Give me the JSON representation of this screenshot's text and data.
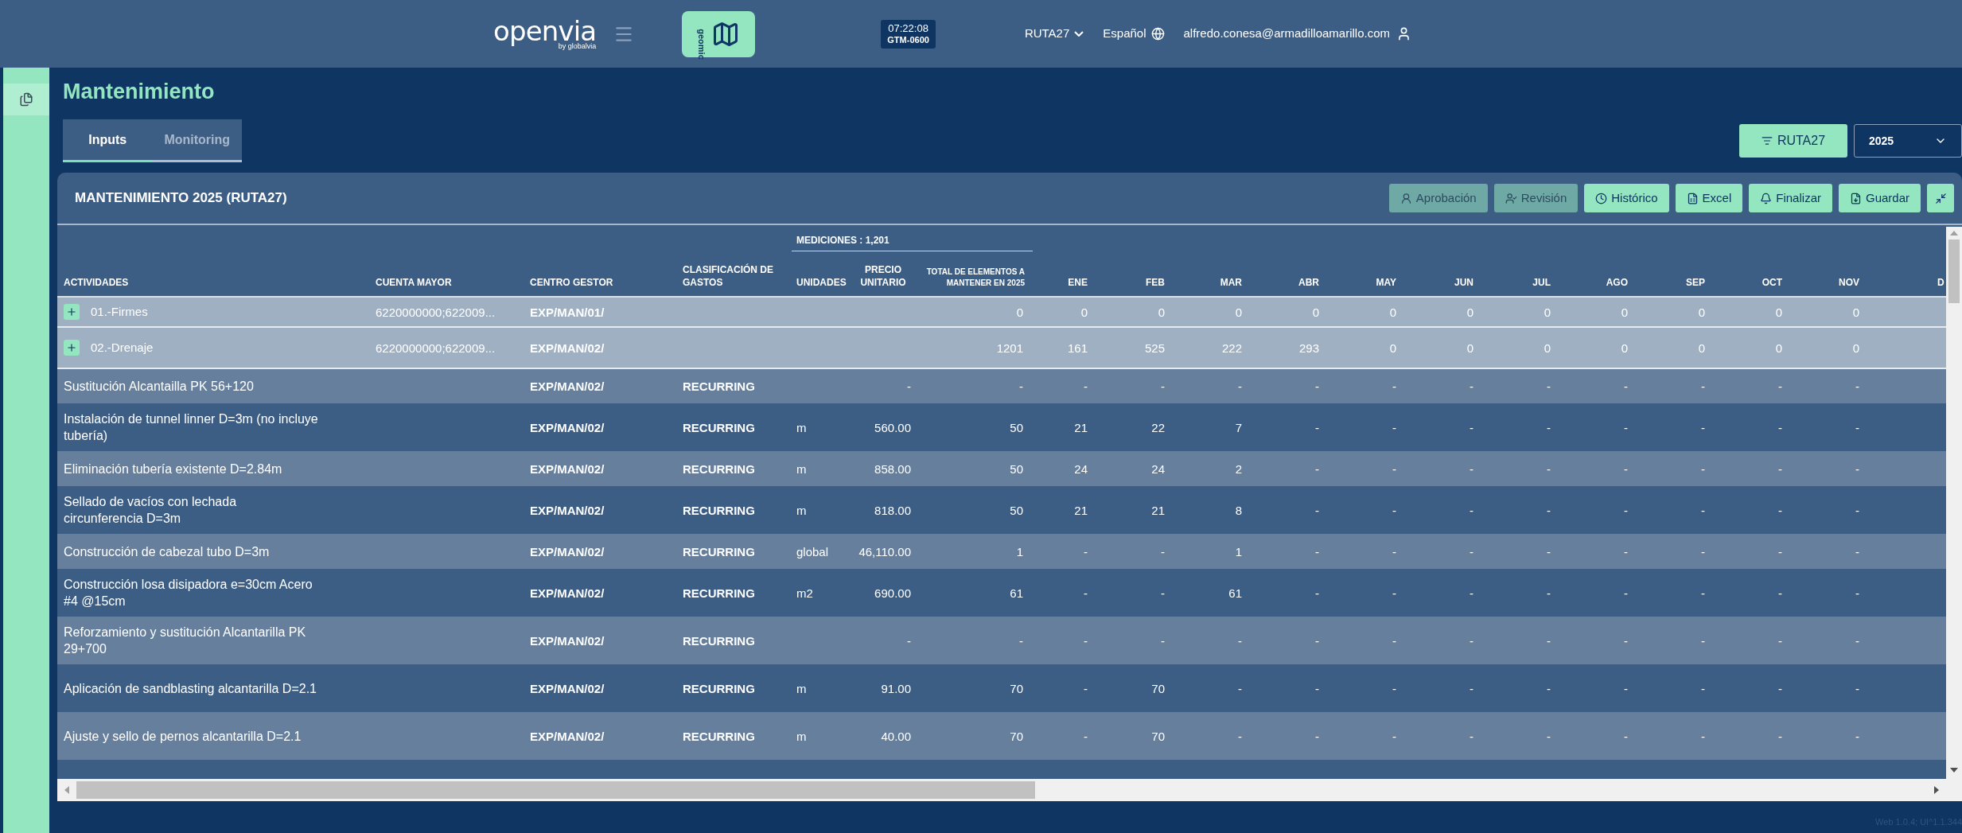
{
  "header": {
    "logo": "openvia",
    "logo_tagline": "by globalvia",
    "app_badge": "geomic",
    "clock": {
      "time": "07:22:08",
      "zone": "GTM-0600"
    },
    "project": "RUTA27",
    "language": "Español",
    "user": "alfredo.conesa@armadilloamarillo.com"
  },
  "sidebar": {
    "items": [
      {
        "selected": true
      }
    ]
  },
  "page": {
    "title": "Mantenimiento",
    "tabs": [
      {
        "label": "Inputs",
        "selected": true
      },
      {
        "label": "Monitoring",
        "selected": false
      }
    ],
    "filter_button": "RUTA27",
    "year_select": "2025"
  },
  "card": {
    "title": "MANTENIMIENTO 2025 (RUTA27)",
    "actions": [
      {
        "label": "Aprobación",
        "kind": "approve",
        "disabled": true
      },
      {
        "label": "Revisión",
        "kind": "review",
        "disabled": true
      },
      {
        "label": "Histórico",
        "kind": "history",
        "disabled": false
      },
      {
        "label": "Excel",
        "kind": "excel",
        "disabled": false
      },
      {
        "label": "Finalizar",
        "kind": "finish",
        "disabled": false
      },
      {
        "label": "Guardar",
        "kind": "save",
        "disabled": false
      },
      {
        "kind": "collapse",
        "disabled": false
      }
    ],
    "table": {
      "group_header": "MEDICIONES : 1,201",
      "columns": [
        "ACTIVIDADES",
        "CUENTA MAYOR",
        "CENTRO GESTOR",
        "CLASIFICACIÓN DE GASTOS",
        "UNIDADES",
        "PRECIO UNITARIO",
        "TOTAL DE ELEMENTOS A MANTENER EN 2025",
        "ENE",
        "FEB",
        "MAR",
        "ABR",
        "MAY",
        "JUN",
        "JUL",
        "AGO",
        "SEP",
        "OCT",
        "NOV",
        "D"
      ],
      "rows": [
        {
          "kind": "group",
          "expanded": false,
          "cells": [
            "01.-Firmes",
            "6220000000;622009...",
            "EXP/MAN/01/",
            "",
            "",
            "",
            "0",
            "0",
            "0",
            "0",
            "0",
            "0",
            "0",
            "0",
            "0",
            "0",
            "0",
            "0"
          ]
        },
        {
          "kind": "group",
          "expanded": false,
          "cells": [
            "02.-Drenaje",
            "6220000000;622009...",
            "EXP/MAN/02/",
            "",
            "",
            "",
            "1201",
            "161",
            "525",
            "222",
            "293",
            "0",
            "0",
            "0",
            "0",
            "0",
            "0",
            "0"
          ]
        },
        {
          "kind": "item",
          "cells": [
            "Sustitución Alcantailla PK 56+120",
            "",
            "EXP/MAN/02/",
            "RECURRING",
            "",
            "-",
            "-",
            "-",
            "-",
            "-",
            "-",
            "-",
            "-",
            "-",
            "-",
            "-",
            "-",
            "-"
          ]
        },
        {
          "kind": "item",
          "cells": [
            "Instalación de tunnel linner D=3m (no incluye tubería)",
            "",
            "EXP/MAN/02/",
            "RECURRING",
            "m",
            "560.00",
            "50",
            "21",
            "22",
            "7",
            "-",
            "-",
            "-",
            "-",
            "-",
            "-",
            "-",
            "-"
          ]
        },
        {
          "kind": "item",
          "cells": [
            "Eliminación tubería existente D=2.84m",
            "",
            "EXP/MAN/02/",
            "RECURRING",
            "m",
            "858.00",
            "50",
            "24",
            "24",
            "2",
            "-",
            "-",
            "-",
            "-",
            "-",
            "-",
            "-",
            "-"
          ]
        },
        {
          "kind": "item",
          "cells": [
            "Sellado de vacíos con lechada circunferencia D=3m",
            "",
            "EXP/MAN/02/",
            "RECURRING",
            "m",
            "818.00",
            "50",
            "21",
            "21",
            "8",
            "-",
            "-",
            "-",
            "-",
            "-",
            "-",
            "-",
            "-"
          ]
        },
        {
          "kind": "item",
          "cells": [
            "Construcción de cabezal tubo D=3m",
            "",
            "EXP/MAN/02/",
            "RECURRING",
            "global",
            "46,110.00",
            "1",
            "-",
            "-",
            "1",
            "-",
            "-",
            "-",
            "-",
            "-",
            "-",
            "-",
            "-"
          ]
        },
        {
          "kind": "item",
          "cells": [
            "Construcción losa disipadora e=30cm Acero #4 @15cm",
            "",
            "EXP/MAN/02/",
            "RECURRING",
            "m2",
            "690.00",
            "61",
            "-",
            "-",
            "61",
            "-",
            "-",
            "-",
            "-",
            "-",
            "-",
            "-",
            "-"
          ]
        },
        {
          "kind": "item",
          "cells": [
            "Reforzamiento y sustitución Alcantarilla PK 29+700",
            "",
            "EXP/MAN/02/",
            "RECURRING",
            "",
            "-",
            "-",
            "-",
            "-",
            "-",
            "-",
            "-",
            "-",
            "-",
            "-",
            "-",
            "-",
            "-"
          ]
        },
        {
          "kind": "item",
          "cells": [
            "Aplicación de sandblasting alcantarilla D=2.1",
            "",
            "EXP/MAN/02/",
            "RECURRING",
            "m",
            "91.00",
            "70",
            "-",
            "70",
            "-",
            "-",
            "-",
            "-",
            "-",
            "-",
            "-",
            "-",
            "-"
          ]
        },
        {
          "kind": "item",
          "cells": [
            "Ajuste y sello de pernos alcantarilla D=2.1",
            "",
            "EXP/MAN/02/",
            "RECURRING",
            "m",
            "40.00",
            "70",
            "-",
            "70",
            "-",
            "-",
            "-",
            "-",
            "-",
            "-",
            "-",
            "-",
            "-"
          ]
        }
      ]
    }
  },
  "footer": {
    "version": "Web 1.0.4; UI^1.1.344"
  }
}
